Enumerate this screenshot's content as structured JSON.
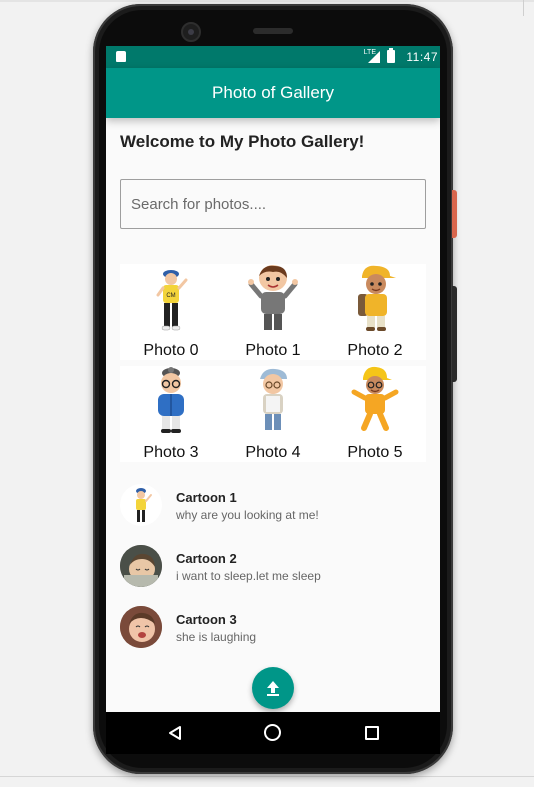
{
  "status_bar": {
    "time": "11:47",
    "network": "LTE"
  },
  "app_bar": {
    "title": "Photo of Gallery"
  },
  "welcome_text": "Welcome to My Photo Gallery!",
  "search": {
    "placeholder": "Search for photos....",
    "value": ""
  },
  "photos": [
    {
      "caption": "Photo 0",
      "icon": "cartoon-boy-yellow-shirt"
    },
    {
      "caption": "Photo 1",
      "icon": "cartoon-boy-waving"
    },
    {
      "caption": "Photo 2",
      "icon": "cartoon-boy-backpack"
    },
    {
      "caption": "Photo 3",
      "icon": "cartoon-boy-blue-jacket"
    },
    {
      "caption": "Photo 4",
      "icon": "cartoon-boy-cap"
    },
    {
      "caption": "Photo 5",
      "icon": "cartoon-boy-yellow-outfit"
    }
  ],
  "cartoons": [
    {
      "title": "Cartoon 1",
      "subtitle": "why are you looking at me!",
      "icon": "cartoon-avatar"
    },
    {
      "title": "Cartoon 2",
      "subtitle": "i want to sleep.let me sleep",
      "icon": "sleeping-baby-avatar"
    },
    {
      "title": "Cartoon 3",
      "subtitle": "she is laughing",
      "icon": "laughing-baby-avatar"
    }
  ],
  "fab": {
    "icon": "upload-icon"
  },
  "nav": {
    "back_icon": "back-icon",
    "home_icon": "home-icon",
    "recents_icon": "recents-icon"
  },
  "colors": {
    "primary": "#009688",
    "primary_dark": "#00796b",
    "background": "#fafafa"
  }
}
